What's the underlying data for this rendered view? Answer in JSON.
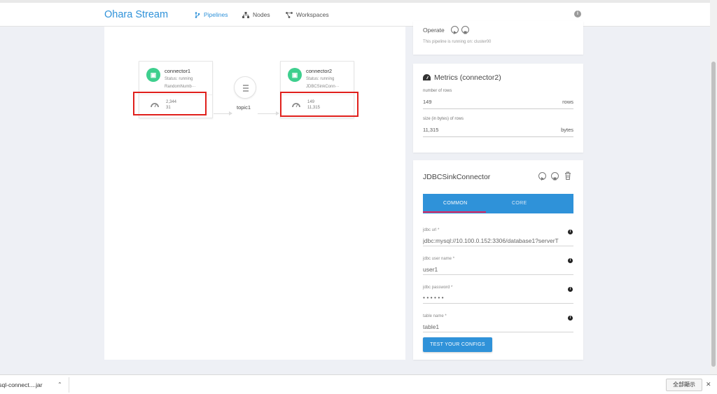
{
  "header": {
    "brand": "Ohara Stream",
    "nav": [
      {
        "label": "Pipelines",
        "active": true,
        "icon": "pipelines-icon"
      },
      {
        "label": "Nodes",
        "active": false,
        "icon": "nodes-icon"
      },
      {
        "label": "Workspaces",
        "active": false,
        "icon": "workspaces-icon"
      }
    ],
    "info_icon": "info-icon"
  },
  "graph": {
    "connector1": {
      "name": "connector1",
      "status": "Status: running",
      "class": "RandomNumb···",
      "metric1": "2,344",
      "metric2": "31"
    },
    "topic": {
      "name": "topic1"
    },
    "connector2": {
      "name": "connector2",
      "status": "Status: running",
      "class": "JDBCSinkConn···",
      "metric1": "149",
      "metric2": "11,315"
    }
  },
  "operate": {
    "label": "Operate",
    "subtext": "This pipeline is running on: cluster00"
  },
  "metrics": {
    "title": "Metrics (connector2)",
    "rows_label": "number of rows",
    "rows_value": "149",
    "rows_unit": "rows",
    "bytes_label": "size (in bytes) of rows",
    "bytes_value": "11,315",
    "bytes_unit": "bytes"
  },
  "connector_panel": {
    "title": "JDBCSinkConnector",
    "tabs": [
      "COMMON",
      "CORE"
    ],
    "active_tab": "COMMON",
    "fields": [
      {
        "label": "jdbc url *",
        "value": "jdbc:mysql://10.100.0.152:3306/database1?serverT"
      },
      {
        "label": "jdbc user name *",
        "value": "user1"
      },
      {
        "label": "jdbc password *",
        "value": "• • • • • •"
      },
      {
        "label": "table name *",
        "value": "table1"
      }
    ],
    "test_button": "TEST YOUR CONFIGS"
  },
  "download_bar": {
    "file": "ysql-connect....jar",
    "show_all": "全部顯示"
  },
  "colors": {
    "accent": "#2f92d9",
    "running": "#3ecf8e",
    "highlight": "#e0201c",
    "tab_indicator": "#e0245e"
  }
}
